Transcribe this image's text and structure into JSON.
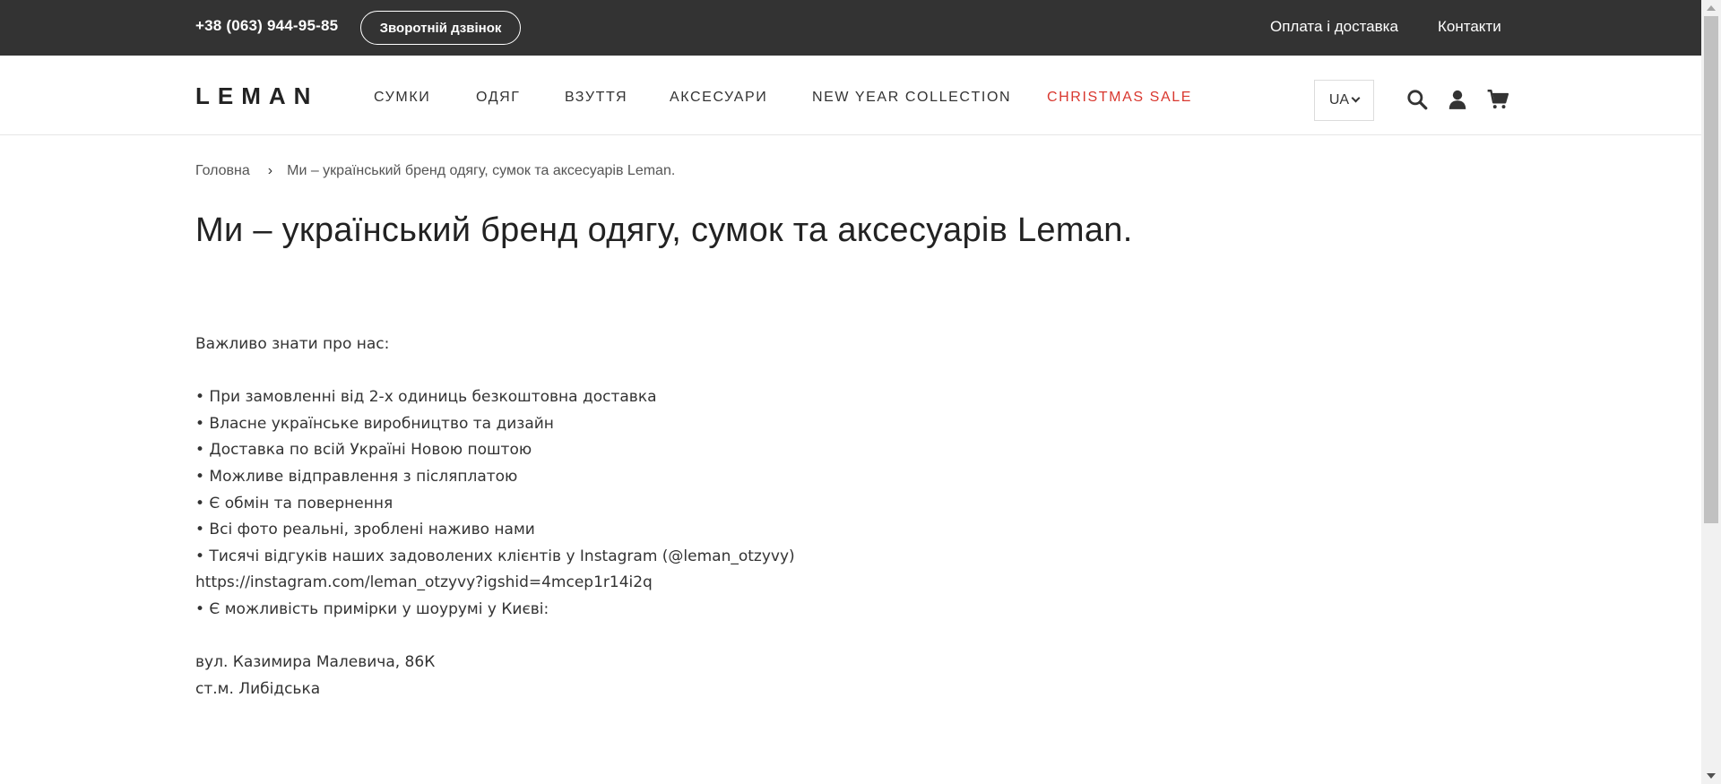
{
  "topbar": {
    "phone": "+38 (063) 944-95-85",
    "callback_label": "Зворотній дзвінок",
    "payment_label": "Оплата і доставка",
    "contacts_label": "Контакти"
  },
  "header": {
    "logo": "LEMAN",
    "nav": [
      {
        "label": "СУМКИ"
      },
      {
        "label": "ОДЯГ"
      },
      {
        "label": "ВЗУТТЯ"
      },
      {
        "label": "АКСЕСУАРИ"
      },
      {
        "label": "NEW YEAR COLLECTION"
      },
      {
        "label": "CHRISTMAS SALE"
      }
    ],
    "lang": "UA",
    "sale_color": "#d9382f",
    "icons": [
      "search-icon",
      "user-icon",
      "cart-icon"
    ]
  },
  "breadcrumb": {
    "home": "Головна",
    "separator": "›",
    "current": "Ми – український бренд одягу, сумок та аксесуарів Leman."
  },
  "page": {
    "title": "Ми – український бренд одягу, сумок та аксесуарів Leman.",
    "intro": "Важливо знати про нас:",
    "bullets": [
      "• При замовленні від 2-х одиниць безкоштовна доставка",
      "• Власне українське виробництво та дизайн",
      "• Доставка по всій Україні Новою поштою",
      "• Можливе відправлення з післяплатою",
      "• Є обмін та повернення",
      "• Всі фото реальні, зроблені наживо нами",
      "• Тисячі відгуків наших задоволених клієнтів у Instagram (@leman_otzyvy)"
    ],
    "instagram_link": "https://instagram.com/leman_otzyvy?igshid=4mcep1r14i2q",
    "fitting": "• Є можливість примірки у шоурумі у Києві:",
    "address_street": "вул. Казимира Малевича, 86К",
    "address_metro": "ст.м. Либідська"
  },
  "colors": {
    "topbar_bg": "#333333",
    "accent_sale": "#d9382f"
  }
}
